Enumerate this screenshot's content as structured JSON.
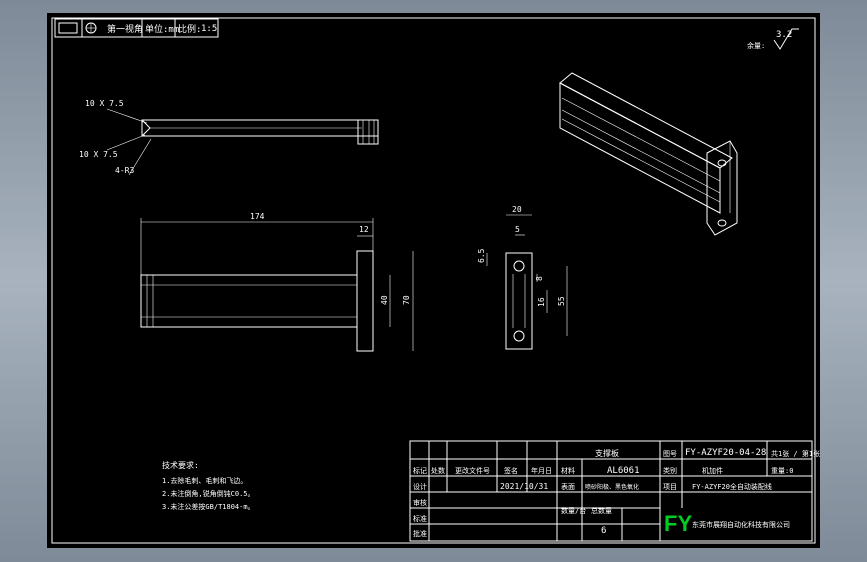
{
  "header": {
    "projection_label": "第一视角",
    "unit_label": "单位:mm",
    "scale_label": "比例:",
    "scale_value": "1:5"
  },
  "roughness": {
    "label": "余量:",
    "value": "3.2"
  },
  "front_view": {
    "chamfer_top": "10 X 7.5",
    "chamfer_bottom": "10 X 7.5",
    "radius": "4-R3"
  },
  "top_view": {
    "length": "174",
    "end": "12",
    "inner": "40",
    "height": "70"
  },
  "side_view": {
    "width": "20",
    "slot": "5",
    "offset": "6.5",
    "gap": "8",
    "inner": "16",
    "height": "55"
  },
  "notes": {
    "title": "技术要求:",
    "lines": [
      "1.去除毛刺、毛刺和飞边。",
      "2.未注倒角,锐角倒钝C0.5。",
      "3.未注公差按GB/T1804-m。"
    ]
  },
  "title_block": {
    "part_name": "支撑板",
    "drawing_no": "FY-AZYF20-04-28",
    "sheet": "共1张 / 第1张",
    "material_label": "材料",
    "material": "AL6061",
    "type_label": "类别",
    "type": "机加件",
    "weight": "重量:0",
    "mark_label": "标记",
    "qty_col": "处数",
    "change_col": "更改文件号",
    "sign_col": "签名",
    "date_col": "年月日",
    "design_label": "设计",
    "date": "2021/10/31",
    "surface_label": "表面",
    "surface": "喷砂阳极、黑色氧化",
    "project_label": "项目",
    "project": "FY-AZYF20全自动装配线",
    "review_label": "审核",
    "standard_label": "标准",
    "qty_label": "数量/台",
    "total_label": "总数量",
    "qty": "6",
    "approve_label": "批准",
    "logo": "FY",
    "company": "东莞市展翔自动化科技有限公司"
  }
}
